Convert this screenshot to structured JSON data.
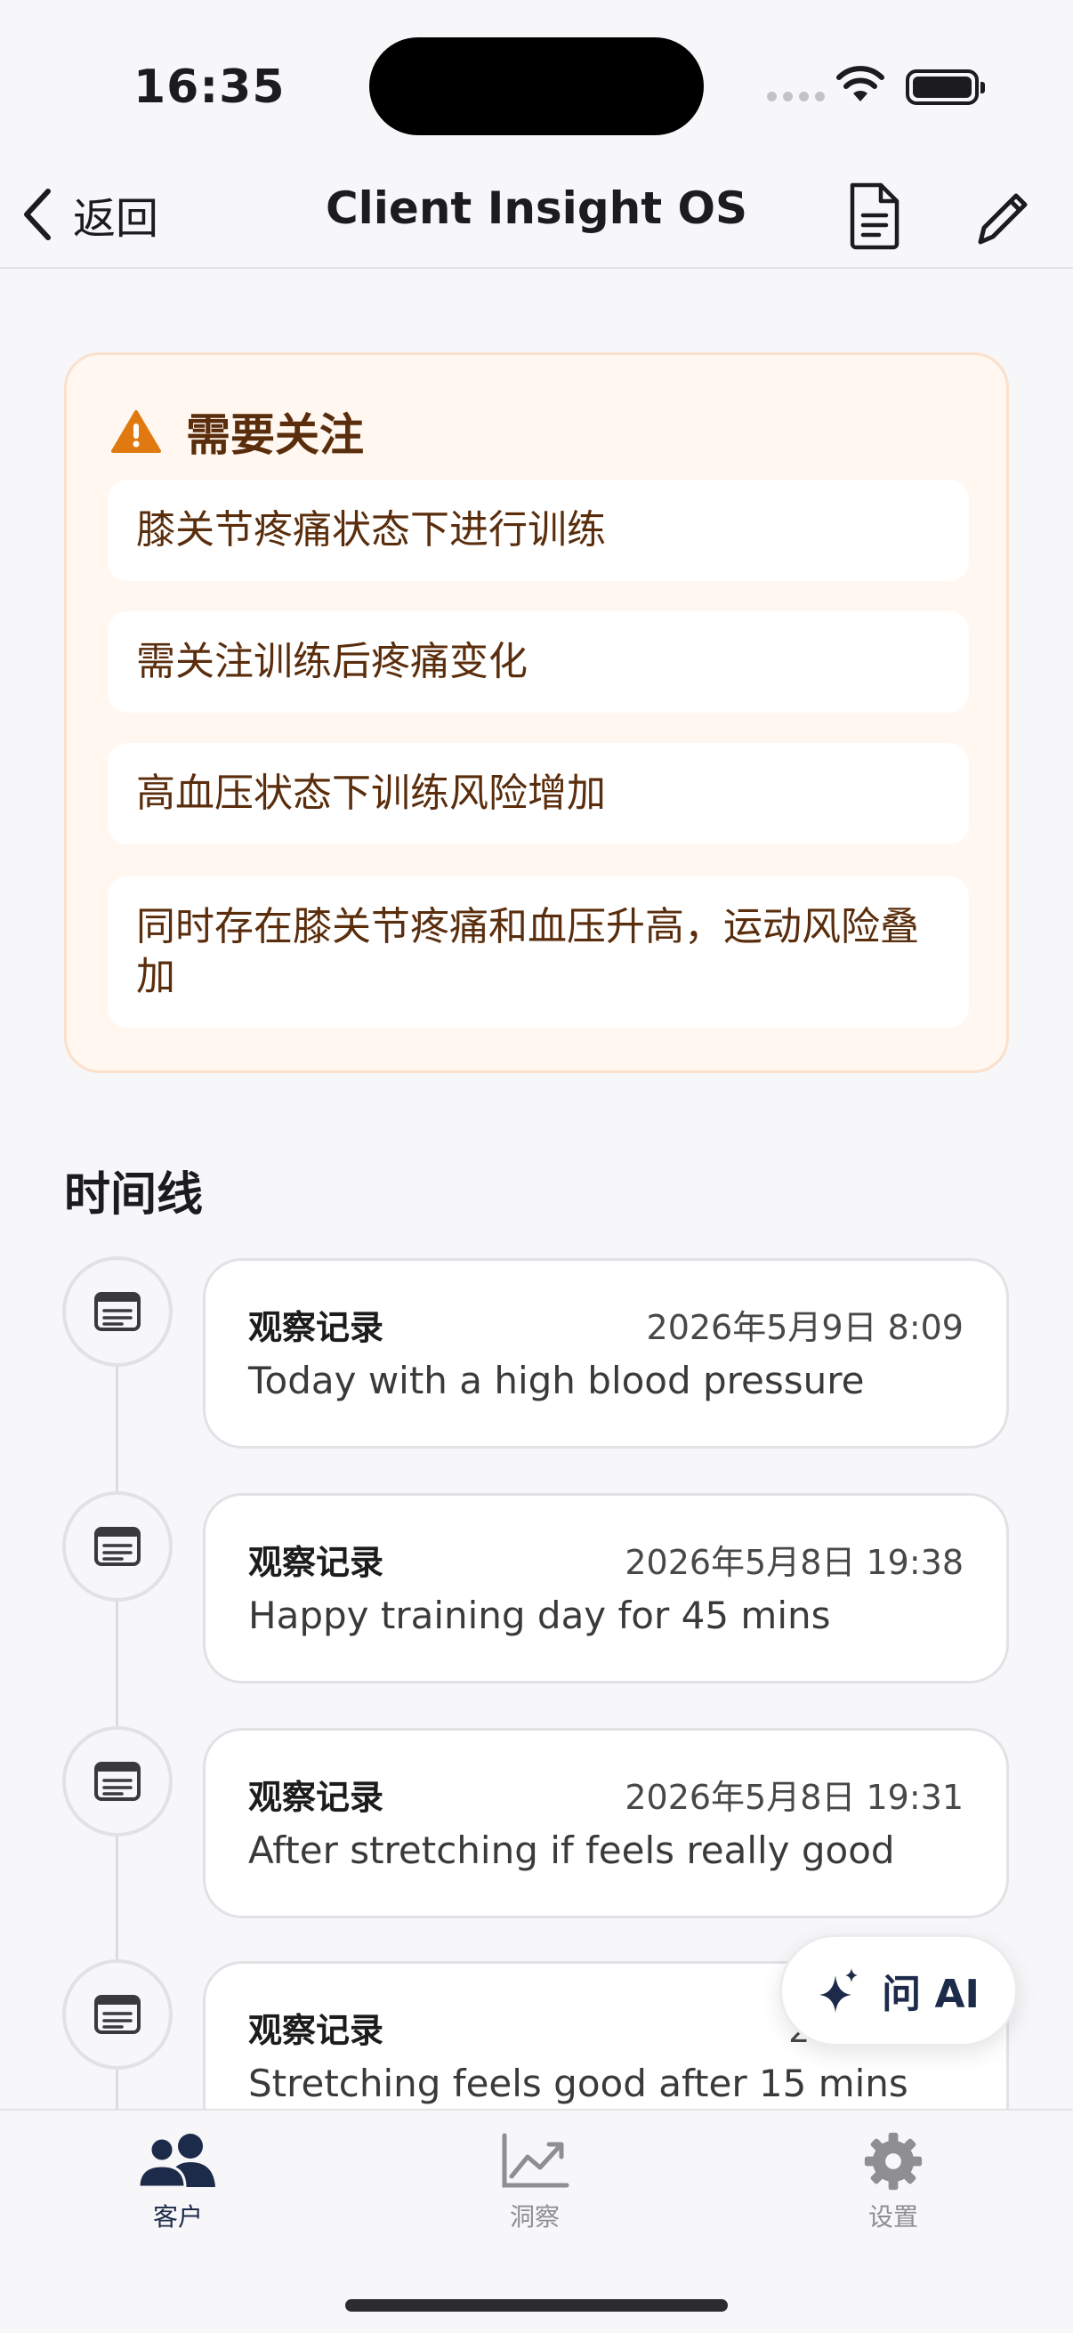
{
  "status_bar": {
    "time": "16:35"
  },
  "nav": {
    "back_label": "返回",
    "title": "Client Insight OS"
  },
  "attention": {
    "title": "需要关注",
    "items": [
      "膝关节疼痛状态下进行训练",
      "需关注训练后疼痛变化",
      "高血压状态下训练风险增加",
      "同时存在膝关节疼痛和血压升高，运动风险叠加"
    ]
  },
  "timeline": {
    "title": "时间线",
    "entries": [
      {
        "type": "观察记录",
        "date": "2026年5月9日 8:09",
        "text": "Today with a high blood pressure"
      },
      {
        "type": "观察记录",
        "date": "2026年5月8日 19:38",
        "text": "Happy training day for 45 mins"
      },
      {
        "type": "观察记录",
        "date": "2026年5月8日 19:31",
        "text": "After stretching if feels really good"
      },
      {
        "type": "观察记录",
        "date": "2026年5月",
        "text": "Stretching feels good after 15 mins"
      }
    ]
  },
  "ask_ai": {
    "label": "问 AI"
  },
  "tabbar": {
    "tabs": [
      {
        "label": "客户",
        "icon": "people-icon",
        "active": true
      },
      {
        "label": "洞察",
        "icon": "chart-icon",
        "active": false
      },
      {
        "label": "设置",
        "icon": "gear-icon",
        "active": false
      }
    ]
  },
  "colors": {
    "warning": "#e07a10",
    "warning_text": "#5a2d0c",
    "active_tab": "#1d2b4a",
    "inactive_tab": "#8e8e93"
  }
}
